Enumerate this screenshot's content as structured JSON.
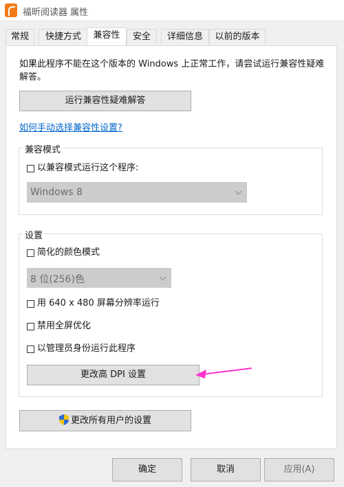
{
  "window": {
    "title": "福昕阅读器 属性"
  },
  "tabs": [
    {
      "label": "常规",
      "active": false
    },
    {
      "label": "快捷方式",
      "active": false
    },
    {
      "label": "兼容性",
      "active": true
    },
    {
      "label": "安全",
      "active": false
    },
    {
      "label": "详细信息",
      "active": false
    },
    {
      "label": "以前的版本",
      "active": false
    }
  ],
  "compat": {
    "intro": "如果此程序不能在这个版本的 Windows 上正常工作，请尝试运行兼容性疑难解答。",
    "troubleshoot_button": "运行兼容性疑难解答",
    "manual_link": "如何手动选择兼容性设置?",
    "mode_group": {
      "label": "兼容模式",
      "checkbox": "以兼容模式运行这个程序:",
      "checked": false,
      "os_select": "Windows 8"
    },
    "settings_group": {
      "label": "设置",
      "reduced_color": "简化的颜色模式",
      "reduced_color_checked": false,
      "color_select": "8 位(256)色",
      "res_640": "用 640 x 480 屏幕分辨率运行",
      "res_640_checked": false,
      "disable_fullscreen_opt": "禁用全屏优化",
      "disable_fullscreen_opt_checked": false,
      "run_as_admin": "以管理员身份运行此程序",
      "run_as_admin_checked": false,
      "dpi_button": "更改高 DPI 设置"
    },
    "all_users_button": "更改所有用户的设置"
  },
  "footer": {
    "ok": "确定",
    "cancel": "取消",
    "apply": "应用(A)"
  },
  "colors": {
    "link": "#0066cc",
    "accent_arrow": "#ff33cc",
    "panel_bg": "#ffffff",
    "window_bg": "#f0f0f0"
  }
}
